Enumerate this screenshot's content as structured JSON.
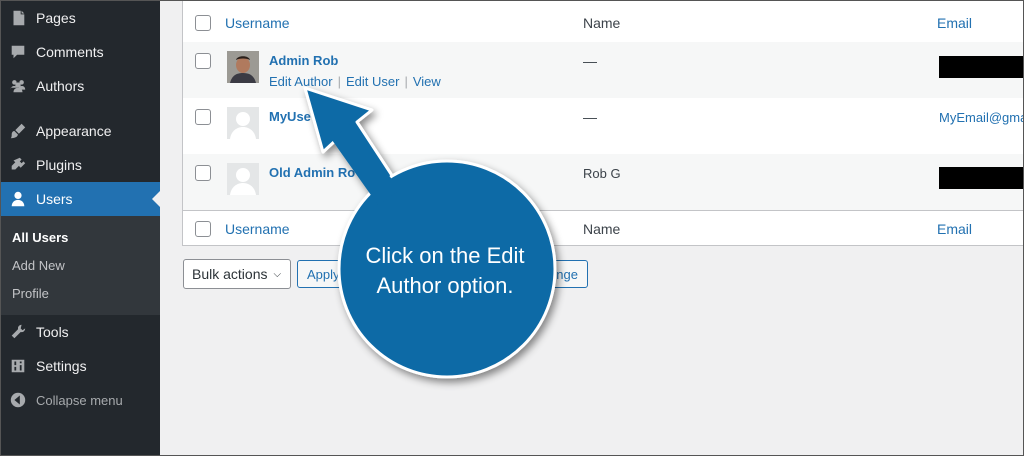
{
  "sidebar": {
    "items": [
      {
        "label": "Pages",
        "icon": "pages-icon"
      },
      {
        "label": "Comments",
        "icon": "comments-icon"
      },
      {
        "label": "Authors",
        "icon": "authors-icon"
      },
      {
        "label": "Appearance",
        "icon": "appearance-icon"
      },
      {
        "label": "Plugins",
        "icon": "plugins-icon"
      },
      {
        "label": "Users",
        "icon": "users-icon"
      },
      {
        "label": "Tools",
        "icon": "tools-icon"
      },
      {
        "label": "Settings",
        "icon": "settings-icon"
      }
    ],
    "submenu": [
      "All Users",
      "Add New",
      "Profile"
    ],
    "collapse_label": "Collapse menu"
  },
  "table": {
    "headers": {
      "username": "Username",
      "name": "Name",
      "email": "Email"
    },
    "rows": [
      {
        "username": "Admin Rob",
        "name": "—",
        "email": "",
        "actions": [
          "Edit Author",
          "Edit User",
          "View"
        ]
      },
      {
        "username": "MyUse",
        "name": "—",
        "email": "MyEmail@gma"
      },
      {
        "username": "Old Admin Ro",
        "name": "Rob G",
        "email": ""
      }
    ]
  },
  "bulk": {
    "select_label": "Bulk actions",
    "apply_label": "Apply",
    "change_label": "nge"
  },
  "callout": {
    "line1": "Click on the Edit",
    "line2": "Author option."
  },
  "colors": {
    "accent": "#2271b1",
    "callout": "#0f6aa6",
    "sidebar": "#23282d"
  }
}
